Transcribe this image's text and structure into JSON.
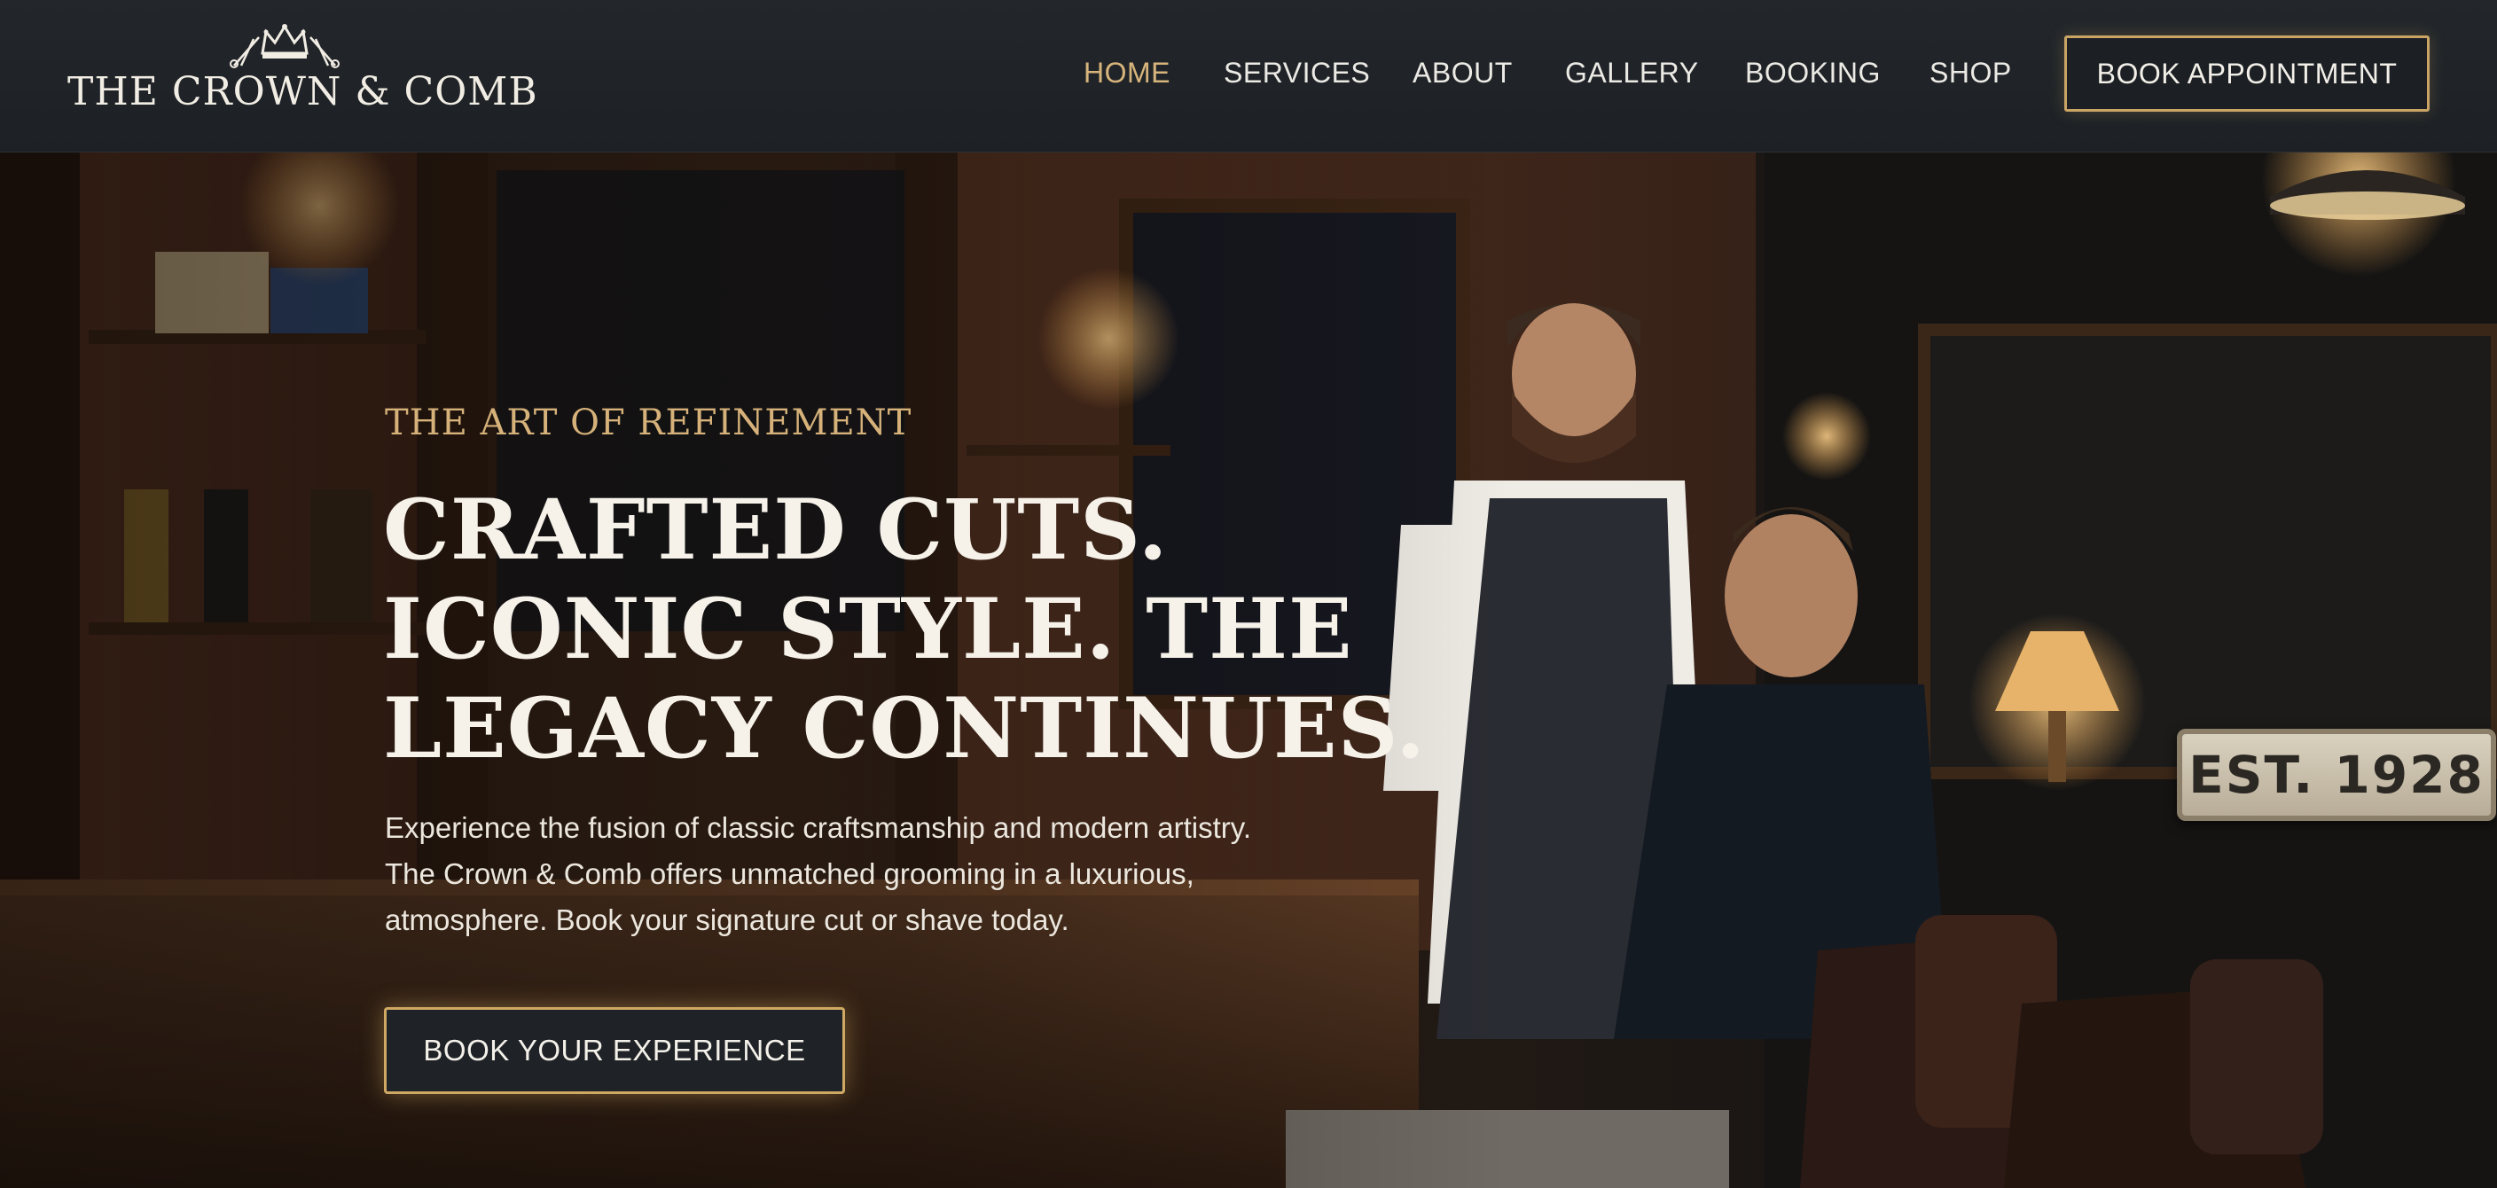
{
  "brand": {
    "name": "THE CROWN & COMB",
    "logo_icon": "crown-scissors-icon"
  },
  "nav": {
    "items": [
      {
        "label": "HOME",
        "active": true
      },
      {
        "label": "SERVICES",
        "active": false
      },
      {
        "label": "ABOUT",
        "active": false
      },
      {
        "label": "GALLERY",
        "active": false
      },
      {
        "label": "BOOKING",
        "active": false
      },
      {
        "label": "SHOP",
        "active": false
      }
    ],
    "cta_label": "BOOK APPOINTMENT"
  },
  "hero": {
    "eyebrow": "THE ART OF REFINEMENT",
    "headline_lines": [
      "CRAFTED CUTS.",
      "ICONIC STYLE. THE",
      "LEGACY CONTINUES."
    ],
    "subcopy_lines": [
      "Experience the fusion of classic craftsmanship and modern artistry.",
      "The Crown & Comb offers unmatched grooming in a luxurious,",
      "atmosphere. Book your signature cut or shave today."
    ],
    "cta_label": "BOOK YOUR EXPERIENCE",
    "sign_text": "EST. 1928",
    "image": "barbershop-interior-barber-cutting-hair"
  },
  "colors": {
    "accent": "#d7b47b",
    "header_bg": "#212529",
    "text": "#f2efe8"
  }
}
